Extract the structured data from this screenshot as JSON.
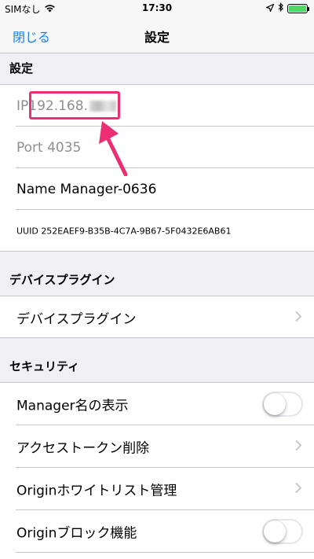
{
  "status_bar": {
    "carrier": "SIMなし",
    "time": "17:30",
    "battery_level": 1.0,
    "battery_color": "#4cd964"
  },
  "nav": {
    "close_label": "閉じる",
    "title": "設定",
    "accent_color": "#1a7ef7"
  },
  "sections": {
    "settings": {
      "header": "設定",
      "ip_prefix": "IP",
      "ip_value": "192.168.",
      "port_label": "Port 4035",
      "name_label": "Name Manager-0636",
      "uuid_label": "UUID 252EAEF9-B35B-4C7A-9B67-5F0432E6AB61"
    },
    "device_plugin": {
      "header": "デバイスプラグイン",
      "item_label": "デバイスプラグイン"
    },
    "security": {
      "header": "セキュリティ",
      "items": [
        {
          "label": "Manager名の表示",
          "control": "toggle",
          "on": false
        },
        {
          "label": "アクセストークン削除",
          "control": "chevron"
        },
        {
          "label": "Originホワイトリスト管理",
          "control": "chevron"
        },
        {
          "label": "Originブロック機能",
          "control": "toggle",
          "on": false
        }
      ]
    }
  },
  "annotation": {
    "highlight_color": "#ec2e72",
    "icons": [
      "wifi-icon",
      "location-arrow-icon",
      "bluetooth-icon",
      "battery-icon",
      "chevron-right-icon",
      "annotation-arrow-icon"
    ]
  }
}
